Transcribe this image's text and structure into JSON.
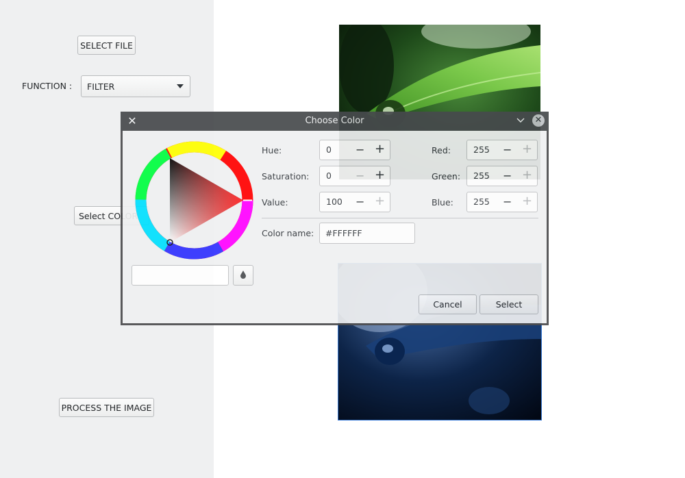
{
  "app": {
    "select_file_label": "SELECT FILE",
    "function_label": "FUNCTION :",
    "function_value": "FILTER",
    "select_color_label": "Select COLOR",
    "process_label": "PROCESS THE IMAGE"
  },
  "dialog": {
    "title": "Choose Color",
    "fields": {
      "hue_label": "Hue:",
      "hue_value": "0",
      "saturation_label": "Saturation:",
      "saturation_value": "0",
      "value_label": "Value:",
      "value_value": "100",
      "red_label": "Red:",
      "red_value": "255",
      "green_label": "Green:",
      "green_value": "255",
      "blue_label": "Blue:",
      "blue_value": "255",
      "color_name_label": "Color name:",
      "color_name_value": "#FFFFFF"
    },
    "cancel_label": "Cancel",
    "select_label": "Select"
  },
  "icons": {
    "close": "close-icon",
    "minimize": "chevron-down-icon",
    "window_close": "window-close-icon",
    "eyedropper": "eyedropper-icon",
    "dropdown": "triangle-down-icon"
  },
  "colors": {
    "panel_bg": "#eff0f1",
    "titlebar": "#474a4d",
    "selected_color": "#FFFFFF"
  }
}
